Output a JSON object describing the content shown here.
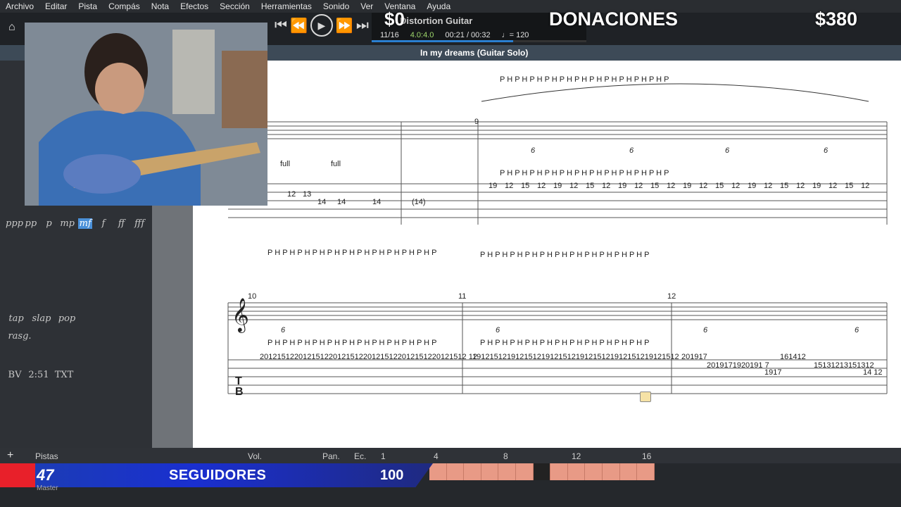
{
  "menu": [
    "Archivo",
    "Editar",
    "Pista",
    "Compás",
    "Nota",
    "Efectos",
    "Sección",
    "Herramientas",
    "Sonido",
    "Ver",
    "Ventana",
    "Ayuda"
  ],
  "lcd": {
    "track_name": "Distortion Guitar",
    "bar_position": "11/16",
    "signature": "4.0:4.0",
    "time": "00:21 / 00:32",
    "tempo": "= 120",
    "progress": 0.66
  },
  "overlay": {
    "donations_label": "DONACIONES",
    "donations_amount": "$380",
    "left_amount": "$0",
    "followers_count": "47",
    "followers_label": "SEGUIDORES",
    "followers_goal": "100"
  },
  "score_title": "In my dreams (Guitar Solo)",
  "dynamics": [
    "ppp",
    "pp",
    "p",
    "mp",
    "mf",
    "f",
    "ff",
    "fff"
  ],
  "techniques": [
    "tap",
    "slap",
    "pop",
    "rasg.",
    "BV",
    "2:51",
    "TXT"
  ],
  "bottom": {
    "tracks_label": "Pistas",
    "vol_label": "Vol.",
    "pan_label": "Pan.",
    "eq_label": "Ec.",
    "bar_numbers": [
      "1",
      "4",
      "8",
      "12",
      "16"
    ],
    "master_label": "Master"
  },
  "notation": {
    "bends": [
      "full",
      "full"
    ],
    "system1_tab_left": [
      "12",
      "13",
      "14",
      "14",
      "14",
      "(14)"
    ],
    "system1_hp": "P H P H P H P H P H P H P H P H P H P H P H P",
    "system1_tab_right": [
      "19",
      "12",
      "15",
      "12",
      "19",
      "12",
      "15",
      "12",
      "19",
      "12",
      "15",
      "12",
      "19",
      "12",
      "15",
      "12",
      "19",
      "12",
      "15",
      "12",
      "19",
      "12",
      "15",
      "12"
    ],
    "system2_hp_a": "P H P H P H P H P H P H P H P H P H P H P H P",
    "system2_hp_b": "P H P H P H P H P H P H P H P H P H P H P H P",
    "system2_tab_a": "201215122012151220121512201215122012151220121512 12",
    "system2_tab_b": "191215121912151219121512191215121912151219121512",
    "system2_tab_c": [
      "201917",
      "2019171920191 7",
      "161412",
      "1917",
      "15131213151312",
      "14 12"
    ],
    "bar_numbers": [
      "9",
      "10",
      "11",
      "12"
    ],
    "tuplet": "6"
  }
}
